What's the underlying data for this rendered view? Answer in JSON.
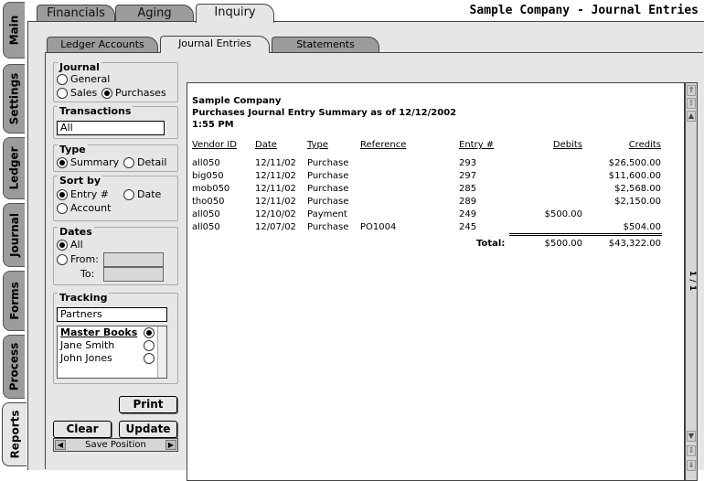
{
  "app_title": "Sample Company - Journal Entries",
  "side_tabs": [
    "Main",
    "Settings",
    "Ledger",
    "Journal",
    "Forms",
    "Process",
    "Reports"
  ],
  "top_tabs": [
    "Financials",
    "Aging",
    "Inquiry"
  ],
  "sub_tabs": [
    "Ledger Accounts",
    "Journal Entries",
    "Statements"
  ],
  "journal": {
    "title": "Journal",
    "general": "General",
    "sales": "Sales",
    "purchases": "Purchases"
  },
  "transactions": {
    "title": "Transactions",
    "value": "All"
  },
  "type": {
    "title": "Type",
    "summary": "Summary",
    "detail": "Detail"
  },
  "sort_by": {
    "title": "Sort by",
    "entry": "Entry #",
    "date": "Date",
    "account": "Account"
  },
  "dates": {
    "title": "Dates",
    "all": "All",
    "from": "From:",
    "to": "To:"
  },
  "tracking": {
    "title": "Tracking",
    "value": "Partners",
    "items": [
      "Master Books",
      "Jane Smith",
      "John Jones"
    ]
  },
  "buttons": {
    "print": "Print",
    "clear": "Clear",
    "update": "Update",
    "save_position": "Save Position"
  },
  "report": {
    "company": "Sample Company",
    "subtitle": "Purchases Journal Entry Summary as of 12/12/2002",
    "time": "1:55 PM",
    "columns": [
      "Vendor ID",
      "Date",
      "Type",
      "Reference",
      "Entry #",
      "Debits",
      "Credits"
    ],
    "rows": [
      [
        "all050",
        "12/11/02",
        "Purchase",
        "",
        "293",
        "",
        "$26,500.00"
      ],
      [
        "big050",
        "12/11/02",
        "Purchase",
        "",
        "297",
        "",
        "$11,600.00"
      ],
      [
        "mob050",
        "12/11/02",
        "Purchase",
        "",
        "285",
        "",
        "$2,568.00"
      ],
      [
        "tho050",
        "12/11/02",
        "Purchase",
        "",
        "289",
        "",
        "$2,150.00"
      ],
      [
        "all050",
        "12/10/02",
        "Payment",
        "",
        "249",
        "$500.00",
        ""
      ],
      [
        "all050",
        "12/07/02",
        "Purchase",
        "PO1004",
        "245",
        "",
        "$504.00"
      ]
    ],
    "total_label": "Total:",
    "total_debits": "$500.00",
    "total_credits": "$43,322.00",
    "page_indicator": "1 / 1"
  }
}
